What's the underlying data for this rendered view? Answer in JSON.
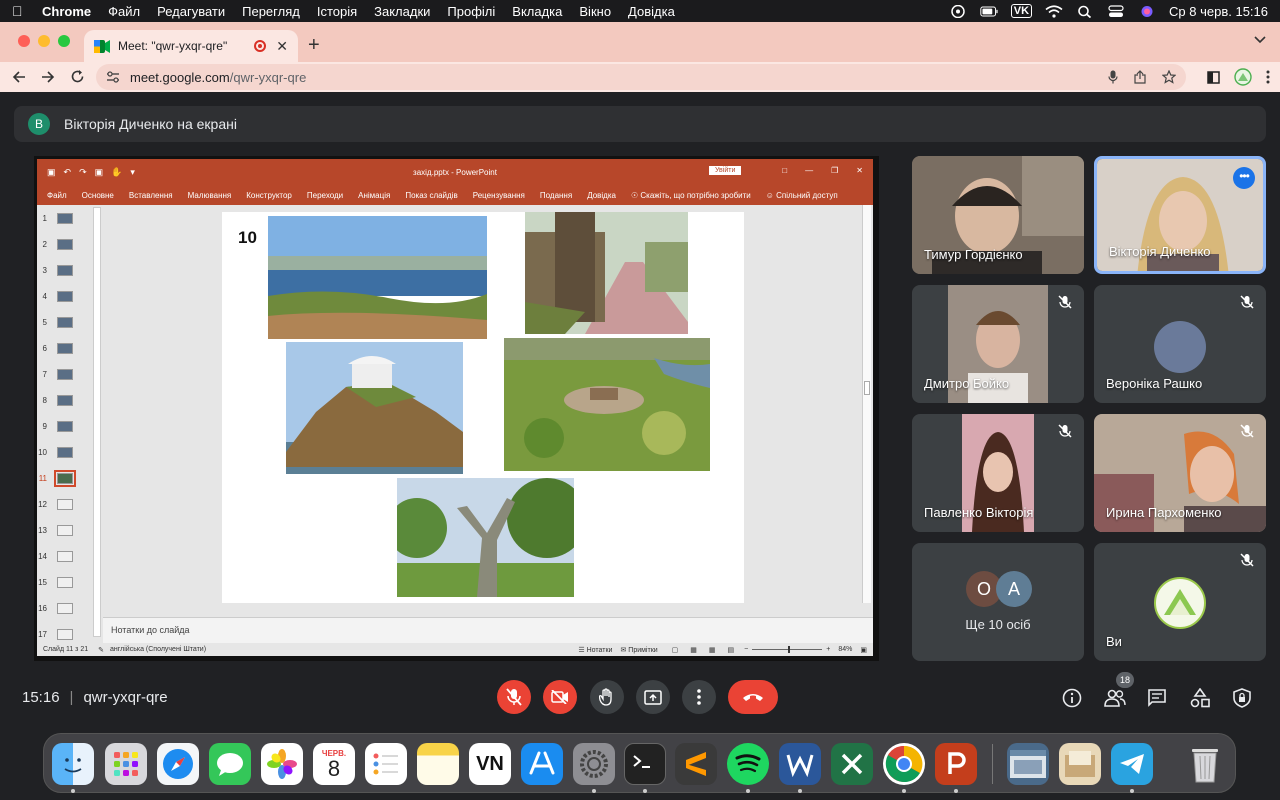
{
  "menubar": {
    "app": "Chrome",
    "items": [
      "Файл",
      "Редагувати",
      "Перегляд",
      "Історія",
      "Закладки",
      "Профілі",
      "Вкладка",
      "Вікно",
      "Довідка"
    ],
    "vk_label": "VK",
    "datetime": "Ср 8 черв.  15:16"
  },
  "browser": {
    "tab_title": "Meet: \"qwr-yxqr-qre\"",
    "url_host": "meet.google.com",
    "url_path": "/qwr-yxqr-qre",
    "tab_close": "✕",
    "new_tab": "+"
  },
  "meet": {
    "presenter_initial": "В",
    "presenter_banner": "Вікторія Диченко на екрані",
    "time": "15:16",
    "meeting_code": "qwr-yxqr-qre",
    "people_count": "18",
    "tiles": [
      {
        "name": "Тимур Гордієнко",
        "muted": false,
        "photo_color": "#6b5a4e"
      },
      {
        "name": "Вікторія Диченко",
        "muted": false,
        "active": true,
        "photo_color": "#c9b8a8"
      },
      {
        "name": "Дмитро Бойко",
        "muted": true,
        "photo_color": "#8a7a6e"
      },
      {
        "name": "Вероніка Рашко",
        "muted": true,
        "photo_color": "#3c4043"
      },
      {
        "name": "Павленко Вікторія",
        "muted": true,
        "photo_color": "#b58a7a"
      },
      {
        "name": "Ирина Пархоменко",
        "muted": true,
        "photo_color": "#a07a6a"
      },
      {
        "name": "Ще 10 осіб",
        "muted": false,
        "initials": [
          "О",
          "А"
        ]
      },
      {
        "name": "Ви",
        "muted": true
      }
    ]
  },
  "ppt": {
    "file_title": "захід.pptx  -  PowerPoint",
    "login": "Увійти",
    "ribbon_tabs": [
      "Файл",
      "Основне",
      "Вставлення",
      "Малювання",
      "Конструктор",
      "Переходи",
      "Анімація",
      "Показ слайдів",
      "Рецензування",
      "Подання",
      "Довідка",
      "Скажіть, що потрібно зробити",
      "Спільний доступ"
    ],
    "slide_number": "10",
    "thumb_numbers": [
      "1",
      "2",
      "3",
      "4",
      "5",
      "6",
      "7",
      "8",
      "9",
      "10",
      "11",
      "12",
      "13",
      "14",
      "15",
      "16",
      "17"
    ],
    "active_thumb": "11",
    "notes_placeholder": "Нотатки до слайда",
    "status_slide": "Слайд 11 з 21",
    "status_lang": "англійська (Сполучені Штати)",
    "status_notes": "Нотатки",
    "status_comments": "Примітки",
    "zoom": "84%"
  },
  "dock": {
    "calendar_month": "ЧЕРВ.",
    "calendar_day": "8",
    "vn_label": "VN"
  }
}
